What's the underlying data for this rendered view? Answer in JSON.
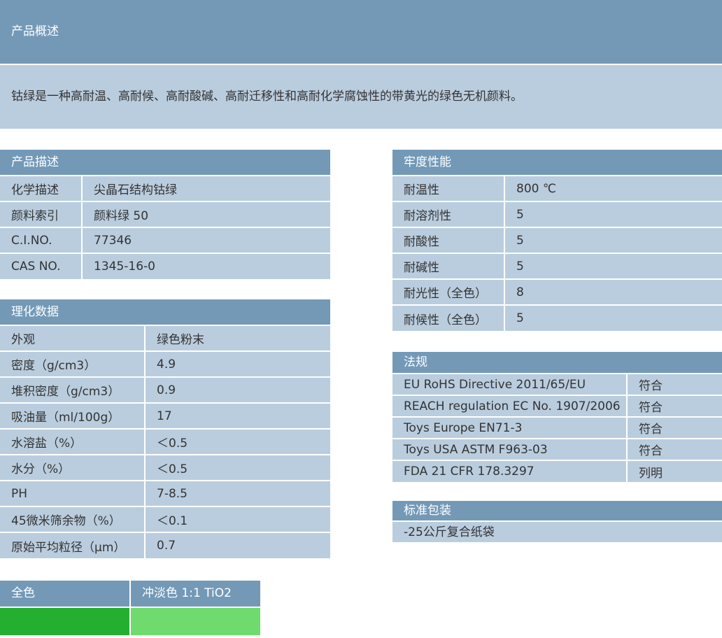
{
  "overview": {
    "title": "产品概述",
    "text": "钴绿是一种高耐温、高耐候、高耐酸碱、高耐迁移性和高耐化学腐蚀性的带黄光的绿色无机颜料。"
  },
  "product_description": {
    "title": "产品描述",
    "rows": [
      {
        "label": "化学描述",
        "value": "尖晶石结构钴绿"
      },
      {
        "label": "颜料索引",
        "value": "颜料绿 50"
      },
      {
        "label": "C.I.NO.",
        "value": "77346"
      },
      {
        "label": "CAS NO.",
        "value": "1345-16-0"
      }
    ]
  },
  "physicochemical": {
    "title": "理化数据",
    "rows": [
      {
        "label": "外观",
        "value": "绿色粉末"
      },
      {
        "label": "密度（g/cm3）",
        "value": "4.9"
      },
      {
        "label": "堆积密度（g/cm3）",
        "value": "0.9"
      },
      {
        "label": "吸油量（ml/100g）",
        "value": "17"
      },
      {
        "label": "水溶盐（%）",
        "value": "＜0.5"
      },
      {
        "label": "水分（%）",
        "value": "＜0.5"
      },
      {
        "label": "PH",
        "value": "7-8.5"
      },
      {
        "label": "45微米筛余物（%）",
        "value": "＜0.1"
      },
      {
        "label": "原始平均粒径（μm）",
        "value": "0.7"
      }
    ]
  },
  "fastness": {
    "title": "牢度性能",
    "rows": [
      {
        "label": "耐温性",
        "value": "800 ℃"
      },
      {
        "label": "耐溶剂性",
        "value": "5"
      },
      {
        "label": "耐酸性",
        "value": "5"
      },
      {
        "label": "耐碱性",
        "value": "5"
      },
      {
        "label": "耐光性（全色）",
        "value": "8"
      },
      {
        "label": "耐候性（全色）",
        "value": "5"
      }
    ]
  },
  "regulations": {
    "title": "法规",
    "rows": [
      {
        "label": "EU RoHS Directive 2011/65/EU",
        "value": "符合"
      },
      {
        "label": "REACH regulation EC No. 1907/2006",
        "value": "符合"
      },
      {
        "label": "Toys Europe EN71-3",
        "value": "符合"
      },
      {
        "label": "Toys USA ASTM F963-03",
        "value": "符合"
      },
      {
        "label": "FDA 21 CFR 178.3297",
        "value": "列明"
      }
    ]
  },
  "packaging": {
    "title": "标准包装",
    "value": "-25公斤复合纸袋"
  },
  "swatches": {
    "full_label": "全色",
    "full_color": "#25af31",
    "tint_label": "冲淡色 1:1 TiO2",
    "tint_color": "#6fdb6e"
  },
  "colors": {
    "header": "#7399b7",
    "cell": "#bacdde"
  }
}
